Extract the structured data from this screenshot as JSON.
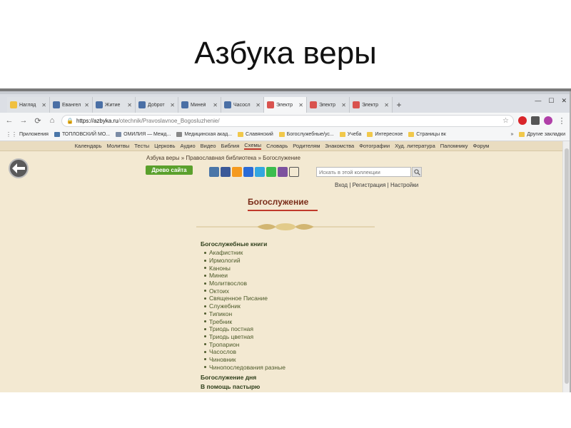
{
  "slide": {
    "title": "Азбука веры"
  },
  "browser": {
    "tabs": [
      {
        "label": "Нагляд",
        "icon_color": "#f0c040"
      },
      {
        "label": "Евангел",
        "icon_color": "#4a6fa5"
      },
      {
        "label": "Житие",
        "icon_color": "#4a6fa5"
      },
      {
        "label": "Доброт",
        "icon_color": "#4a6fa5"
      },
      {
        "label": "Миней",
        "icon_color": "#4a6fa5"
      },
      {
        "label": "Часосл",
        "icon_color": "#4a6fa5"
      },
      {
        "label": "Электр",
        "icon_color": "#d9534f"
      },
      {
        "label": "Электр",
        "icon_color": "#d9534f"
      },
      {
        "label": "Электр",
        "icon_color": "#d9534f"
      }
    ],
    "url_host": "https://azbyka.ru",
    "url_path": "/otechnik/Pravoslavnoe_Bogosluzhenie/",
    "bookmarks": [
      {
        "label": "Приложения"
      },
      {
        "label": "ТОПЛОВСКИЙ МО..."
      },
      {
        "label": "ОМИЛИЯ — Межд..."
      },
      {
        "label": "Медицинская акад..."
      },
      {
        "label": "Славянский"
      },
      {
        "label": "Богослужебные/ус..."
      },
      {
        "label": "Учеба"
      },
      {
        "label": "Интересное"
      },
      {
        "label": "Страницы вк"
      }
    ],
    "more_bookmarks": "»",
    "other_bookmarks": "Другие закладки"
  },
  "site": {
    "menu": [
      "Календарь",
      "Молитвы",
      "Тесты",
      "Церковь",
      "Аудио",
      "Видео",
      "Библия",
      "Схемы",
      "Словарь",
      "Родителям",
      "Знакомства",
      "Фотографии",
      "Худ. литература",
      "Паломнику",
      "Форум"
    ],
    "active_menu": "Схемы",
    "breadcrumb": "Азбука веры » Православная библиотека » Богослужение",
    "tree_button": "Древо сайта",
    "search_placeholder": "Искать в этой коллекции",
    "auth": {
      "login": "Вход",
      "sep": "|",
      "register": "Регистрация",
      "settings": "Настройки"
    },
    "heading": "Богослужение",
    "section_books": "Богослужебные книги",
    "books": [
      "Акафистник",
      "Ирмологий",
      "Каноны",
      "Минеи",
      "Молитвослов",
      "Октоих",
      "Священное Писание",
      "Служебник",
      "Типикон",
      "Требник",
      "Триодь постная",
      "Триодь цветная",
      "Тропарион",
      "Часослов",
      "Чиновник",
      "Чинопоследования разные"
    ],
    "section_day": "Богослужение дня",
    "section_pastor": "В помощь пастырю"
  }
}
